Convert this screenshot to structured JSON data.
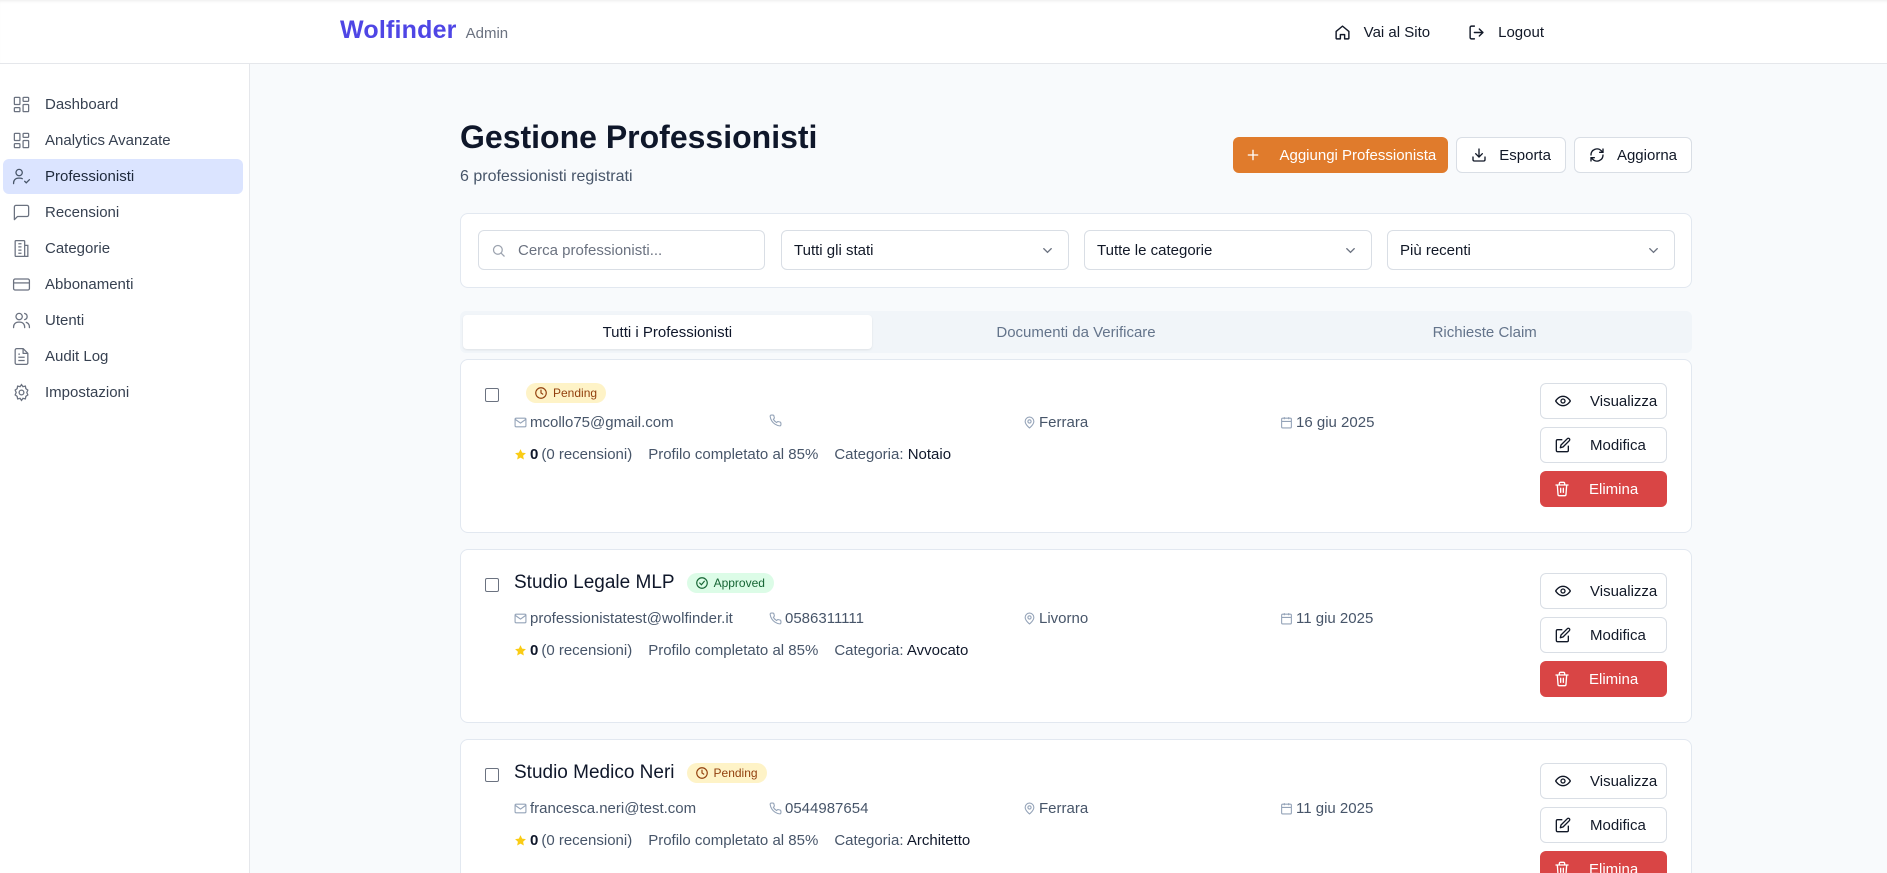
{
  "brand": {
    "name": "Wolfinder",
    "sub": "Admin"
  },
  "topnav": {
    "site": "Vai al Sito",
    "logout": "Logout"
  },
  "sidebar": {
    "items": [
      {
        "label": "Dashboard",
        "icon": "dashboard-icon"
      },
      {
        "label": "Analytics Avanzate",
        "icon": "analytics-icon"
      },
      {
        "label": "Professionisti",
        "icon": "user-check-icon",
        "active": true
      },
      {
        "label": "Recensioni",
        "icon": "message-icon"
      },
      {
        "label": "Categorie",
        "icon": "building-icon"
      },
      {
        "label": "Abbonamenti",
        "icon": "credit-card-icon"
      },
      {
        "label": "Utenti",
        "icon": "users-icon"
      },
      {
        "label": "Audit Log",
        "icon": "file-text-icon"
      },
      {
        "label": "Impostazioni",
        "icon": "gear-icon"
      }
    ]
  },
  "page": {
    "title": "Gestione Professionisti",
    "subtitle": "6 professionisti registrati",
    "add_label": "Aggiungi Professionista",
    "export_label": "Esporta",
    "refresh_label": "Aggiorna"
  },
  "filters": {
    "search_placeholder": "Cerca professionisti...",
    "status": "Tutti gli stati",
    "category": "Tutte le categorie",
    "sort": "Più recenti"
  },
  "tabs": [
    "Tutti i Professionisti",
    "Documenti da Verificare",
    "Richieste Claim"
  ],
  "actions": {
    "view": "Visualizza",
    "edit": "Modifica",
    "delete": "Elimina"
  },
  "labels": {
    "reviews": "(0 recensioni)",
    "profile": "Profilo completato al 85%",
    "category_prefix": "Categoria:"
  },
  "professionals": [
    {
      "name": "",
      "status": "Pending",
      "email": "mcollo75@gmail.com",
      "phone": "",
      "city": "Ferrara",
      "date": "16 giu 2025",
      "rating": "0",
      "category": "Notaio"
    },
    {
      "name": "Studio Legale MLP",
      "status": "Approved",
      "email": "professionistatest@wolfinder.it",
      "phone": "0586311111",
      "city": "Livorno",
      "date": "11 giu 2025",
      "rating": "0",
      "category": "Avvocato"
    },
    {
      "name": "Studio Medico Neri",
      "status": "Pending",
      "email": "francesca.neri@test.com",
      "phone": "0544987654",
      "city": "Ferrara",
      "date": "11 giu 2025",
      "rating": "0",
      "category": "Architetto"
    }
  ],
  "colors": {
    "brand": "#4f46e5",
    "accent": "#e07b2c",
    "danger": "#d94545",
    "active_nav": "#dbe4ff"
  }
}
